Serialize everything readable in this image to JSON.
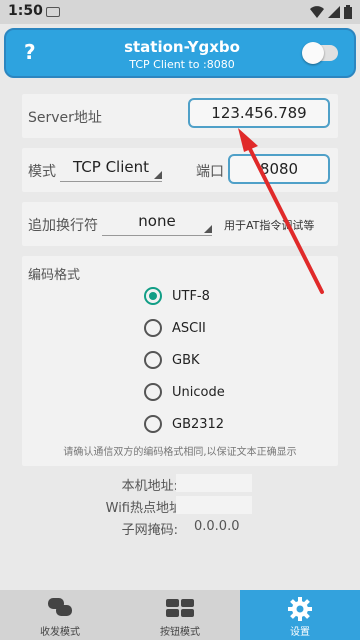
{
  "status_bar": {
    "time": "1:50"
  },
  "header": {
    "help": "?",
    "title": "station-Ygxbo",
    "subtitle": "TCP Client to :8080"
  },
  "server": {
    "label": "Server地址",
    "value": "123.456.789"
  },
  "mode": {
    "label": "模式",
    "value": "TCP Client",
    "port_label": "端口",
    "port_value": "8080"
  },
  "newline": {
    "label": "追加换行符",
    "value": "none",
    "note": "用于AT指令调试等"
  },
  "encoding": {
    "label": "编码格式",
    "options": [
      "UTF-8",
      "ASCII",
      "GBK",
      "Unicode",
      "GB2312"
    ],
    "selected": "UTF-8",
    "hint": "请确认通信双方的编码格式相同,以保证文本正确显示"
  },
  "network": {
    "local_addr_label": "本机地址:",
    "wifi_label": "Wifi热点地址",
    "subnet_label": "子网掩码:",
    "subnet_value": "0.0.0.0"
  },
  "nav": {
    "items": [
      {
        "label": "收发模式",
        "icon": "chat-bubbles-icon"
      },
      {
        "label": "按钮模式",
        "icon": "button-grid-icon"
      },
      {
        "label": "设置",
        "icon": "gear-icon"
      }
    ],
    "active": "设置"
  },
  "colors": {
    "accent": "#2ea3df",
    "radio_checked": "#119e86",
    "arrow": "#e02a2a"
  }
}
